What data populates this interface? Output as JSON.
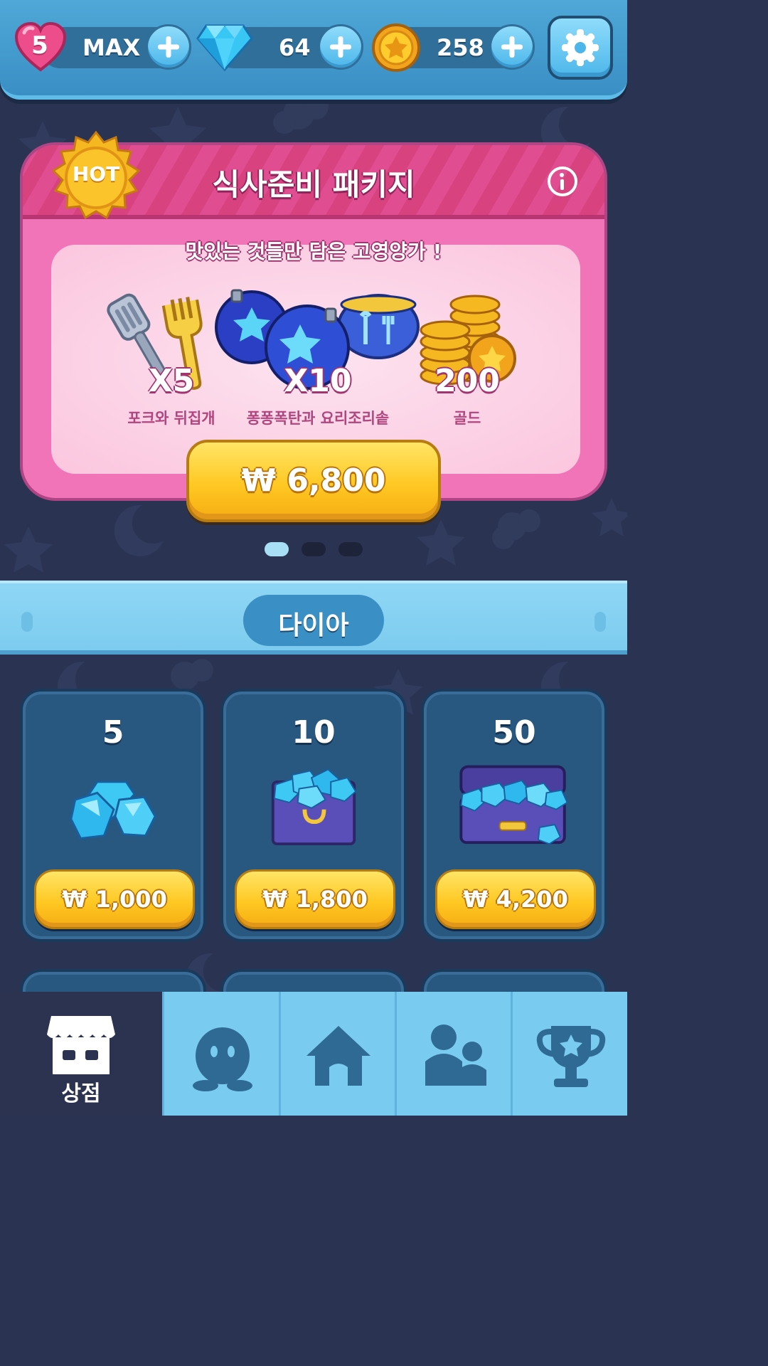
{
  "topbar": {
    "lives": {
      "count": "5",
      "status": "MAX"
    },
    "diamonds": {
      "value": "64"
    },
    "gold": {
      "value": "258"
    }
  },
  "package": {
    "badge": "HOT",
    "title": "식사준비 패키지",
    "subtitle": "맛있는 것들만 담은 고영양가 !",
    "items": [
      {
        "qty": "X5",
        "label": "포크와 뒤집개"
      },
      {
        "qty": "X10",
        "label": "퐁퐁폭탄과 요리조리솥"
      },
      {
        "qty": "200",
        "label": "골드"
      }
    ],
    "price": "₩ 6,800",
    "carousel": {
      "count": 3,
      "active_index": 0
    }
  },
  "section": {
    "title": "다이아"
  },
  "diamond_offers": [
    {
      "amount": "5",
      "price": "₩ 1,000"
    },
    {
      "amount": "10",
      "price": "₩ 1,800"
    },
    {
      "amount": "50",
      "price": "₩ 4,200"
    }
  ],
  "bottom_nav": {
    "tabs": [
      {
        "icon": "shop-icon",
        "label": "상점",
        "active": true
      },
      {
        "icon": "character-icon",
        "label": "",
        "active": false
      },
      {
        "icon": "home-icon",
        "label": "",
        "active": false
      },
      {
        "icon": "friends-icon",
        "label": "",
        "active": false
      },
      {
        "icon": "trophy-icon",
        "label": "",
        "active": false
      }
    ]
  },
  "colors": {
    "background": "#2a3352",
    "topbar": "#4fa8d8",
    "package_pink": "#f174b8",
    "price_gold": "#ffc823",
    "card_blue": "#285780",
    "nav_light": "#79cbf0",
    "nav_active": "#2b3350"
  }
}
